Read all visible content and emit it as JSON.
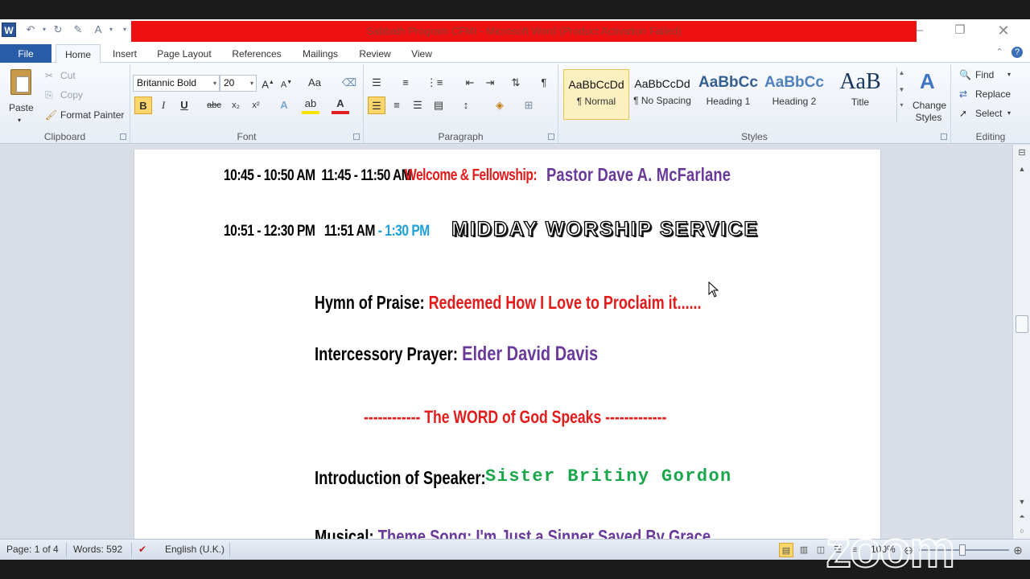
{
  "window": {
    "title": "Sabbath Program CFMI  -  Microsoft Word (Product Activation Failed)"
  },
  "tabs": [
    {
      "label": "File"
    },
    {
      "label": "Home"
    },
    {
      "label": "Insert"
    },
    {
      "label": "Page Layout"
    },
    {
      "label": "References"
    },
    {
      "label": "Mailings"
    },
    {
      "label": "Review"
    },
    {
      "label": "View"
    }
  ],
  "clipboard": {
    "paste": "Paste",
    "cut": "Cut",
    "copy": "Copy",
    "format_painter": "Format Painter",
    "label": "Clipboard"
  },
  "font": {
    "name": "Britannic Bold",
    "size": "20",
    "label": "Font"
  },
  "paragraph": {
    "label": "Paragraph"
  },
  "styles": {
    "items": [
      {
        "preview": "AaBbCcDd",
        "name": "¶ Normal"
      },
      {
        "preview": "AaBbCcDd",
        "name": "¶ No Spacing"
      },
      {
        "preview": "AaBbCc",
        "name": "Heading 1"
      },
      {
        "preview": "AaBbCc",
        "name": "Heading 2"
      },
      {
        "preview": "AaB",
        "name": "Title"
      }
    ],
    "change_styles": "Change Styles",
    "label": "Styles"
  },
  "editing": {
    "find": "Find",
    "replace": "Replace",
    "select": "Select",
    "label": "Editing"
  },
  "document": {
    "line1": {
      "time1": "10:45 - 10:50 AM",
      "time2": "11:45 - 11:50 AM",
      "label": "Welcome & Fellowship:",
      "person": "Pastor Dave A. McFarlane"
    },
    "line2": {
      "time1": "10:51 - 12:30 PM",
      "time2a": "11:51 AM",
      "time2b": " - 1:30 PM",
      "heading": "MIDDAY WORSHIP SERVICE"
    },
    "hymn": {
      "label": "Hymn of Praise",
      "value": "Redeemed How I Love to Proclaim it......"
    },
    "prayer": {
      "label": "Intercessory Prayer",
      "value": "Elder David Davis"
    },
    "word_divider": "------------ The WORD of God Speaks -------------",
    "intro": {
      "label": "Introduction of Speaker",
      "value": "Sister Britiny Gordon"
    },
    "musical": {
      "label": "Musical:",
      "value": "Theme Song: I'm Just a Sinner Saved By Grace"
    }
  },
  "status": {
    "page": "Page: 1 of 4",
    "words": "Words: 592",
    "language": "English (U.K.)",
    "zoom": "100%"
  },
  "watermark": "zoom"
}
